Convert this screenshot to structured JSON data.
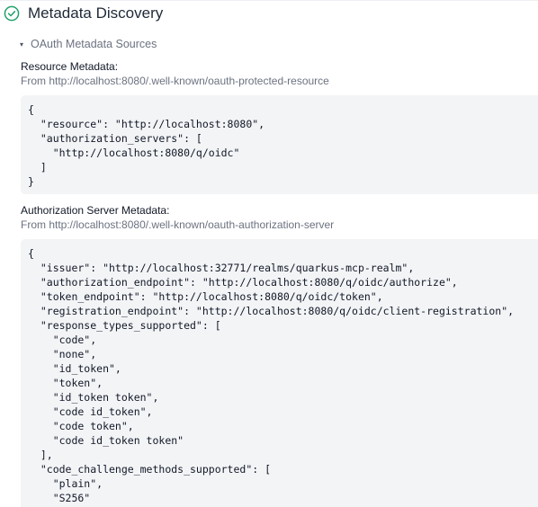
{
  "section": {
    "title": "Metadata Discovery",
    "status_icon": "check-circle-icon",
    "accent": "#22a06b"
  },
  "details": {
    "summary": "OAuth Metadata Sources",
    "caret": "▾"
  },
  "resource_metadata": {
    "label": "Resource Metadata:",
    "source": "From http://localhost:8080/.well-known/oauth-protected-resource",
    "json": "{\n  \"resource\": \"http://localhost:8080\",\n  \"authorization_servers\": [\n    \"http://localhost:8080/q/oidc\"\n  ]\n}"
  },
  "authorization_server_metadata": {
    "label": "Authorization Server Metadata:",
    "source": "From http://localhost:8080/.well-known/oauth-authorization-server",
    "json": "{\n  \"issuer\": \"http://localhost:32771/realms/quarkus-mcp-realm\",\n  \"authorization_endpoint\": \"http://localhost:8080/q/oidc/authorize\",\n  \"token_endpoint\": \"http://localhost:8080/q/oidc/token\",\n  \"registration_endpoint\": \"http://localhost:8080/q/oidc/client-registration\",\n  \"response_types_supported\": [\n    \"code\",\n    \"none\",\n    \"id_token\",\n    \"token\",\n    \"id_token token\",\n    \"code id_token\",\n    \"code token\",\n    \"code id_token token\"\n  ],\n  \"code_challenge_methods_supported\": [\n    \"plain\",\n    \"S256\""
  }
}
